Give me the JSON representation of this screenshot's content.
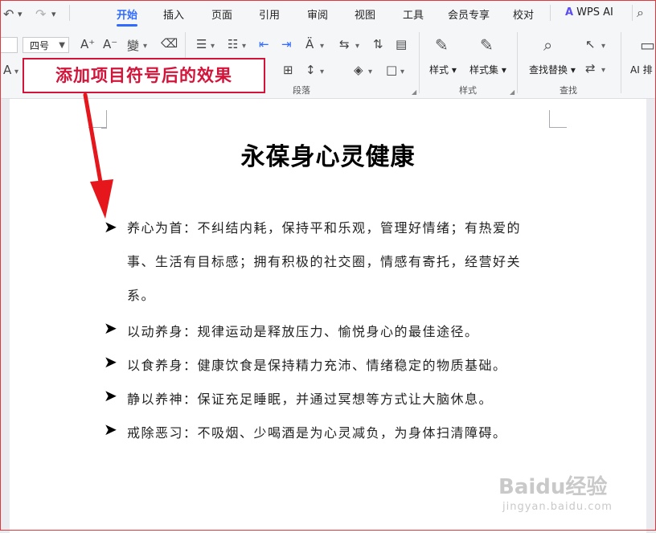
{
  "quick_access": {
    "undo_icon": "↶",
    "redo_icon": "↷",
    "dropdown_icon": "⌄"
  },
  "menu": {
    "items": [
      "开始",
      "插入",
      "页面",
      "引用",
      "审阅",
      "视图",
      "工具",
      "会员专享",
      "校对"
    ],
    "active": "开始",
    "ai_label": "WPS AI"
  },
  "toolbar": {
    "font_size": "四号",
    "groups": {
      "paragraph": "段落",
      "styles": "样式",
      "find": "查找"
    },
    "buttons": {
      "style": "样式",
      "style_set": "样式集",
      "find_replace": "查找替换",
      "ai_partial": "AI 排"
    }
  },
  "callout": {
    "text": "添加项目符号后的效果"
  },
  "document": {
    "title": "永葆身心灵健康",
    "bullet_symbol": "➤",
    "items": [
      {
        "lines": [
          "养心为首：不纠结内耗，保持平和乐观，管理好情绪；有热爱的",
          "事、生活有目标感；拥有积极的社交圈，情感有寄托，经营好关",
          "系。"
        ]
      },
      {
        "lines": [
          "以动养身：规律运动是释放压力、愉悦身心的最佳途径。"
        ]
      },
      {
        "lines": [
          "以食养身：健康饮食是保持精力充沛、情绪稳定的物质基础。"
        ]
      },
      {
        "lines": [
          "静以养神：保证充足睡眠，并通过冥想等方式让大脑休息。"
        ]
      },
      {
        "lines": [
          "戒除恶习：不吸烟、少喝酒是为心灵减负，为身体扫清障碍。"
        ]
      }
    ]
  },
  "watermark": {
    "brand": "Baidu经验",
    "url": "jingyan.baidu.com"
  },
  "colors": {
    "accent": "#2f6bff",
    "callout": "#d2143a"
  }
}
